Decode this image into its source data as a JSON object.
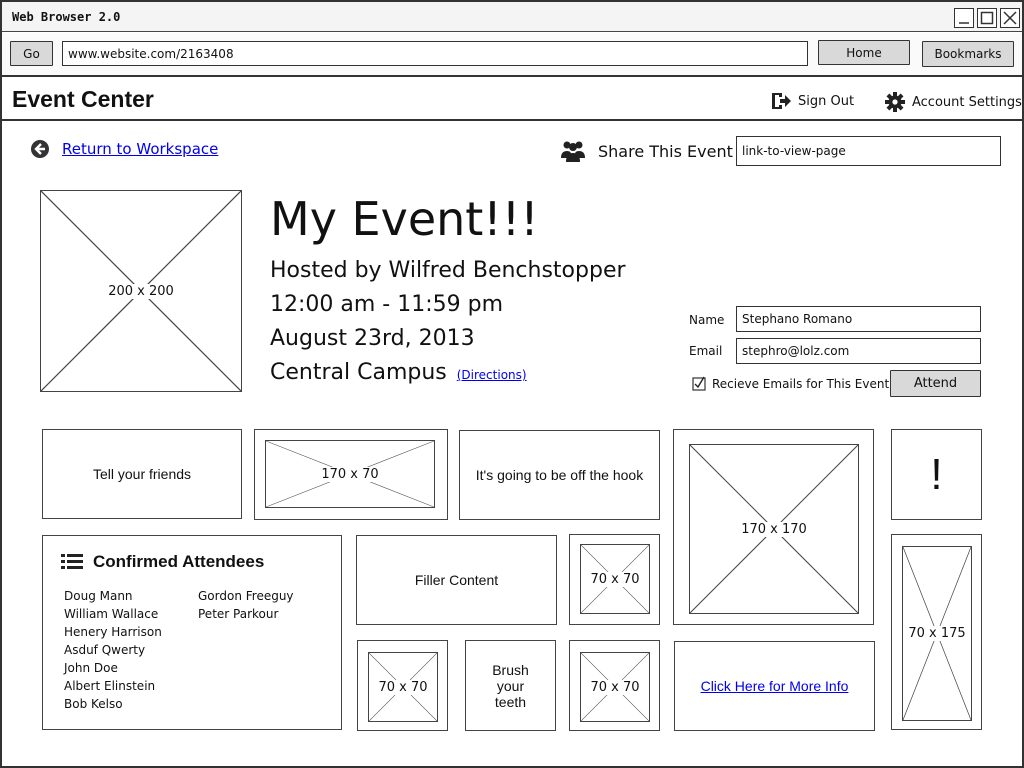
{
  "window": {
    "title": "Web Browser 2.0"
  },
  "toolbar": {
    "go_label": "Go",
    "url": "www.website.com/2163408",
    "home_label": "Home",
    "bookmarks_label": "Bookmarks"
  },
  "header": {
    "title": "Event Center",
    "sign_out": "Sign Out",
    "account_settings": "Account Settings"
  },
  "nav": {
    "return_link": "Return to Workspace",
    "share_label": "Share This Event",
    "share_value": "link-to-view-page"
  },
  "event": {
    "image_label": "200 x 200",
    "title": "My Event!!!",
    "host": "Hosted by Wilfred Benchstopper",
    "time": "12:00 am - 11:59 pm",
    "date": "August 23rd, 2013",
    "location": "Central Campus",
    "directions": "(Directions)"
  },
  "form": {
    "name_label": "Name",
    "name_value": "Stephano Romano",
    "email_label": "Email",
    "email_value": "stephro@lolz.com",
    "checkbox_label": "Recieve Emails for This Event",
    "checkbox_checked": true,
    "attend_label": "Attend"
  },
  "tiles": {
    "tell_friends": "Tell your friends",
    "img_170x70": "170 x 70",
    "off_hook": "It's going to be off the hook",
    "img_170x170": "170 x 170",
    "exclaim": "!",
    "filler": "Filler Content",
    "img_70x70_a": "70 x 70",
    "img_70x70_b": "70 x 70",
    "brush": "Brush\nyour\nteeth",
    "img_70x70_c": "70 x 70",
    "more_info": "Click Here for More Info",
    "img_70x175": "70 x 175"
  },
  "attendees": {
    "heading": "Confirmed Attendees",
    "col1": [
      "Doug Mann",
      "William Wallace",
      "Henery Harrison",
      "Asduf Qwerty",
      "John Doe",
      "Albert Elinstein",
      "Bob Kelso"
    ],
    "col2": [
      "Gordon Freeguy",
      "Peter Parkour"
    ]
  }
}
